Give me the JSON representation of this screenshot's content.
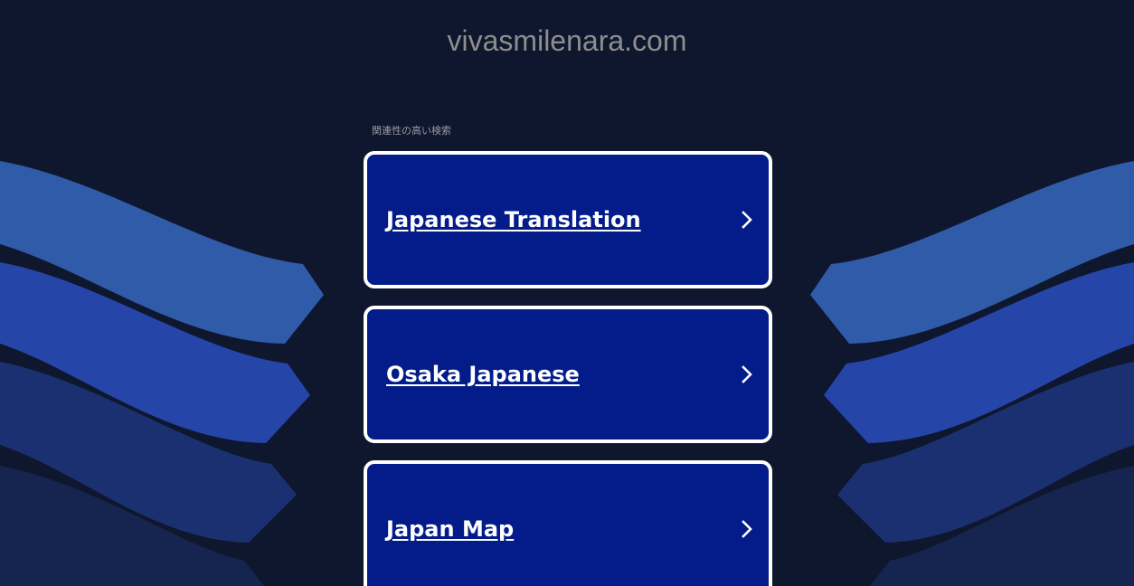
{
  "header": {
    "domain": "vivasmilenara.com"
  },
  "related": {
    "label": "関連性の高い検索"
  },
  "results": [
    {
      "label": "Japanese Translation",
      "icon": "chevron-right-icon"
    },
    {
      "label": "Osaka Japanese",
      "icon": "chevron-right-icon"
    },
    {
      "label": "Japan Map",
      "icon": "chevron-right-icon"
    }
  ],
  "colors": {
    "background": "#0f172e",
    "card": "#031c8a",
    "card_border": "#ffffff",
    "wave_light": "#305ba8",
    "wave_mid": "#2546a8",
    "wave_dark": "#1a3070",
    "wave_darkest": "#15254f"
  }
}
